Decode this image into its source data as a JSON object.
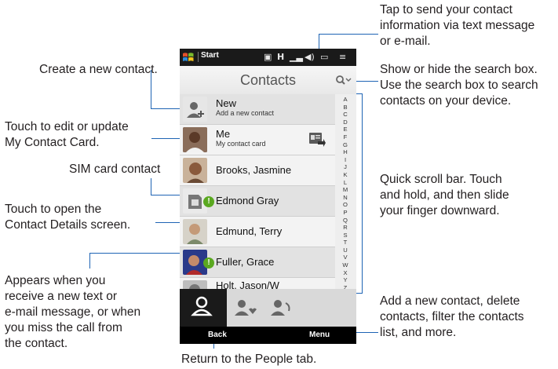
{
  "callouts": {
    "create_contact": "Create a new contact.",
    "edit_card": "Touch to edit or update\nMy Contact Card.",
    "sim_card": "SIM card contact",
    "contact_details": "Touch to open the\nContact Details screen.",
    "new_message": "Appears when you\nreceive a new text or\ne-mail message, or when\nyou miss the call from\nthe contact.",
    "send_info": "Tap to send your contact\ninformation via text message\nor e-mail.",
    "search_box": "Show or hide the search box.\nUse the search box to search\ncontacts on your device.",
    "quick_scroll": "Quick scroll bar. Touch\nand hold, and then slide\nyour finger downward.",
    "menu": "Add a new contact, delete\ncontacts, filter the contacts\nlist, and more.",
    "back": "Return to the People tab."
  },
  "phone": {
    "status": {
      "start": "Start"
    },
    "title": "Contacts",
    "new_contact": {
      "name": "New",
      "sub": "Add a new contact"
    },
    "me": {
      "name": "Me",
      "sub": "My contact card"
    },
    "contacts": [
      "Brooks, Jasmine",
      "Edmond Gray",
      "Edmund, Terry",
      "Fuller, Grace",
      "Holt, Jason/W"
    ],
    "alphabet": [
      "A",
      "B",
      "C",
      "D",
      "E",
      "F",
      "G",
      "H",
      "I",
      "J",
      "K",
      "L",
      "M",
      "N",
      "O",
      "P",
      "Q",
      "R",
      "S",
      "T",
      "U",
      "V",
      "W",
      "X",
      "Y",
      "Z"
    ],
    "softkeys": {
      "back": "Back",
      "menu": "Menu"
    }
  },
  "colors": {
    "leader": "#1e64b4",
    "badge": "#5aa820",
    "bar": "#000000"
  }
}
